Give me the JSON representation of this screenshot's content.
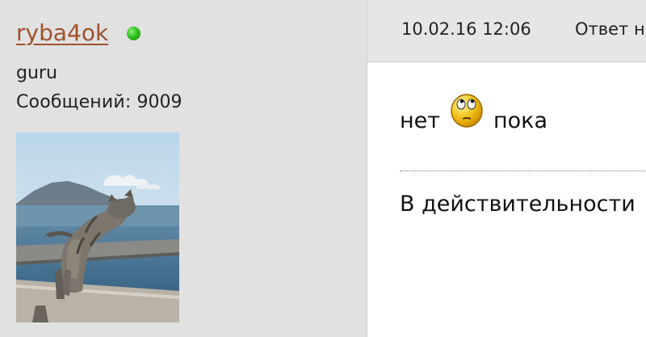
{
  "user": {
    "name": "ryba4ok",
    "status": "online",
    "rank": "guru",
    "posts_label": "Сообщений:",
    "posts_count": "9009"
  },
  "post": {
    "date": "10.02.16 12:06",
    "reply_label": "Ответ н",
    "message_before": "нет",
    "message_after": "пока",
    "smiley": "rolling-eyes-smiley-icon",
    "following_text": "В действительности"
  },
  "colors": {
    "sidebar_bg": "#e1e1e1",
    "username": "#a0522d",
    "online_dot": "#2fbf1f",
    "header_bg": "#e6e6e6"
  }
}
